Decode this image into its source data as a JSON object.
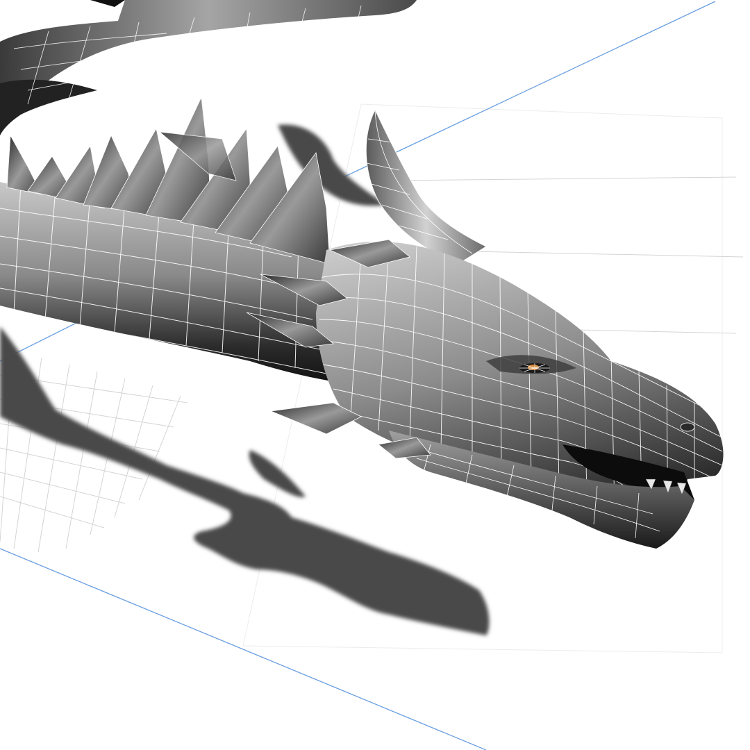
{
  "viewport": {
    "background": "#ffffff",
    "grid_line_color": "#d4d4d4",
    "axis_line_color": "#6a9fe0",
    "shadow_color": "#4a4a4a",
    "mesh_fill_light": "#b8b8b8",
    "mesh_fill_dark": "#1e1e1e",
    "wireframe_color": "#ffffff",
    "eye_color": "#d98a3a"
  },
  "model": {
    "subject": "dragon-head-mesh",
    "display_mode": "smooth-shaded-with-wireframe"
  }
}
